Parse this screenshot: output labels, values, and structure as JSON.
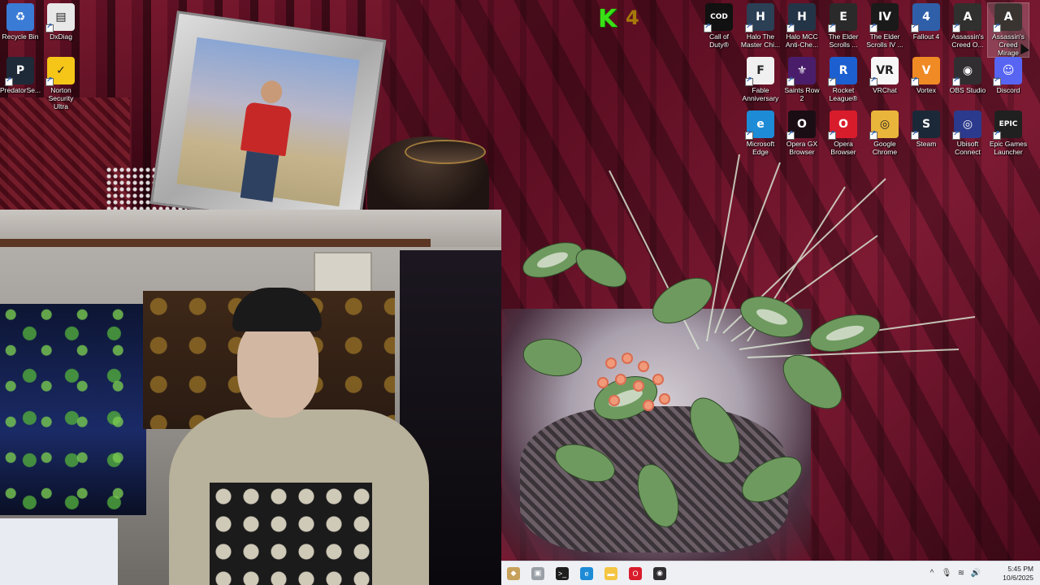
{
  "desktop": {
    "left_icons": [
      {
        "id": "recycle-bin",
        "label": "Recycle Bin",
        "color": "#3a7bd5",
        "glyph": "♻"
      },
      {
        "id": "dxdiag",
        "label": "DxDiag",
        "color": "#e8e8e8",
        "glyph": "▤"
      },
      {
        "id": "predatorsense",
        "label": "PredatorSe...",
        "color": "#1e2a38",
        "glyph": "P"
      },
      {
        "id": "norton",
        "label": "Norton\nSecurity Ultra",
        "color": "#f5c518",
        "glyph": "✓"
      }
    ],
    "right_icons": [
      {
        "id": "call-of-duty",
        "label": "Call of\nDuty®",
        "color": "#111111",
        "glyph": "COD"
      },
      {
        "id": "halo-mcc",
        "label": "Halo The\nMaster Chi...",
        "color": "#2b3f55",
        "glyph": "H"
      },
      {
        "id": "halo-mcc-anticheat",
        "label": "Halo MCC\nAnti-Che...",
        "color": "#243447",
        "glyph": "H"
      },
      {
        "id": "elder-scrolls",
        "label": "The Elder\nScrolls ...",
        "color": "#2a2a2a",
        "glyph": "E"
      },
      {
        "id": "oblivion",
        "label": "The Elder\nScrolls IV ...",
        "color": "#1a1a1a",
        "glyph": "IV"
      },
      {
        "id": "fallout4",
        "label": "Fallout 4",
        "color": "#2f5fa8",
        "glyph": "4"
      },
      {
        "id": "ac-odyssey",
        "label": "Assassin's\nCreed O...",
        "color": "#30302e",
        "glyph": "A"
      },
      {
        "id": "ac-mirage",
        "label": "Assassin's\nCreed Mirage",
        "color": "#3a3430",
        "glyph": "A"
      },
      {
        "id": "fable",
        "label": "Fable\nAnniversary",
        "color": "#f0f0f0",
        "glyph": "F"
      },
      {
        "id": "saints-row-2",
        "label": "Saints Row 2",
        "color": "#4a1d6b",
        "glyph": "⚜"
      },
      {
        "id": "rocket-league",
        "label": "Rocket\nLeague®",
        "color": "#1c5fd0",
        "glyph": "R"
      },
      {
        "id": "vrchat",
        "label": "VRChat",
        "color": "#f7f7f7",
        "glyph": "VR"
      },
      {
        "id": "vortex",
        "label": "Vortex",
        "color": "#f08a24",
        "glyph": "V"
      },
      {
        "id": "obs",
        "label": "OBS Studio",
        "color": "#302e31",
        "glyph": "◉"
      },
      {
        "id": "discord",
        "label": "Discord",
        "color": "#5865f2",
        "glyph": "☺"
      },
      {
        "id": "edge",
        "label": "Microsoft\nEdge",
        "color": "#1e8bd6",
        "glyph": "e"
      },
      {
        "id": "opera-gx",
        "label": "Opera GX\nBrowser",
        "color": "#1b0d14",
        "glyph": "O"
      },
      {
        "id": "opera",
        "label": "Opera\nBrowser",
        "color": "#d91c2c",
        "glyph": "O"
      },
      {
        "id": "chrome",
        "label": "Google\nChrome",
        "color": "#e9b53a",
        "glyph": "◎"
      },
      {
        "id": "steam",
        "label": "Steam",
        "color": "#1b2838",
        "glyph": "S"
      },
      {
        "id": "ubisoft",
        "label": "Ubisoft\nConnect",
        "color": "#2b3a8c",
        "glyph": "◎"
      },
      {
        "id": "epic",
        "label": "Epic Games\nLauncher",
        "color": "#202020",
        "glyph": "EPIC"
      }
    ]
  },
  "stream_logo": {
    "letter": "K",
    "sub": "4"
  },
  "taskbar": {
    "apps": [
      {
        "id": "taskbar-app-1",
        "icon": "app-icon",
        "color": "#c7a15a"
      },
      {
        "id": "taskbar-app-2",
        "icon": "window-icon",
        "color": "#9aa0a6"
      },
      {
        "id": "taskbar-terminal",
        "icon": "terminal-icon",
        "color": "#1e1e1e"
      },
      {
        "id": "taskbar-edge",
        "icon": "edge-icon",
        "color": "#1e8bd6"
      },
      {
        "id": "taskbar-explorer",
        "icon": "folder-icon",
        "color": "#f4c542"
      },
      {
        "id": "taskbar-opera",
        "icon": "opera-icon",
        "color": "#d91c2c"
      },
      {
        "id": "taskbar-obs",
        "icon": "obs-icon",
        "color": "#302e31"
      }
    ],
    "tray": {
      "chevron": "^",
      "time": "5:45 PM",
      "date": "10/6/2025"
    }
  }
}
